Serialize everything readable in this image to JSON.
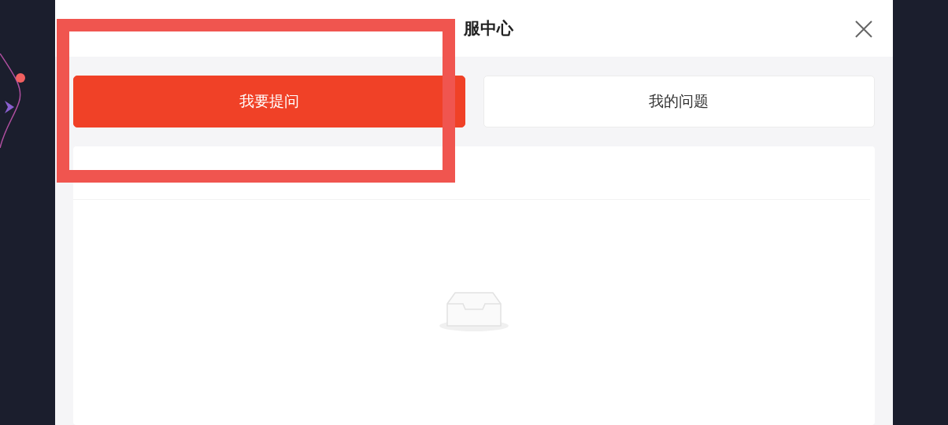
{
  "dialog": {
    "title": "服中心"
  },
  "tabs": [
    {
      "label": "我要提问",
      "selected": true
    },
    {
      "label": "我的问题",
      "selected": false
    }
  ],
  "section": {
    "empty": true
  }
}
